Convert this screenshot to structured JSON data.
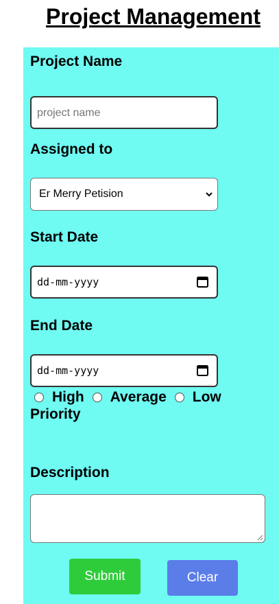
{
  "title": "Project Management",
  "form": {
    "project_name": {
      "label": "Project Name",
      "placeholder": "project name",
      "value": ""
    },
    "assigned_to": {
      "label": "Assigned to",
      "selected": "Er Merry Petision"
    },
    "start_date": {
      "label": "Start Date",
      "value": "dd-mm-yyyy"
    },
    "end_date": {
      "label": "End Date",
      "value": "dd-mm-yyyy"
    },
    "priority": {
      "label": "Priority",
      "options": [
        "High",
        "Average",
        "Low"
      ],
      "selected": null
    },
    "description": {
      "label": "Description",
      "value": ""
    },
    "buttons": {
      "submit": "Submit",
      "clear": "Clear"
    }
  },
  "colors": {
    "panel_background": "#6ffaf2",
    "submit_button": "#2ecc3a",
    "clear_button": "#5a7de8"
  },
  "icons": {
    "select_chevron": "chevron-down-icon",
    "date_picker": "calendar-icon",
    "textarea_resize": "resize-grip-icon"
  }
}
